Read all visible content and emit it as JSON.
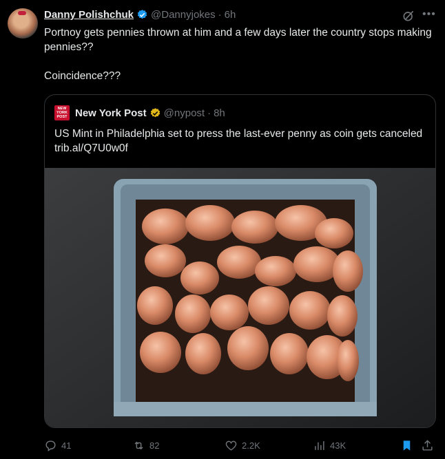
{
  "author": {
    "name": "Danny Polishchuk",
    "handle": "@Dannyjokes",
    "time": "6h"
  },
  "tweet": {
    "line1": "Portnoy gets pennies thrown at him and a few days later the country stops making pennies??",
    "line2": "Coincidence???"
  },
  "quote": {
    "logo_text": "NEW YORK POST",
    "name": "New York Post",
    "handle": "@nypost",
    "time": "8h",
    "text": "US Mint in Philadelphia set to press the last-ever penny as coin gets canceled trib.al/Q7U0w0f"
  },
  "actions": {
    "replies": "41",
    "reposts": "82",
    "likes": "2.2K",
    "views": "43K"
  },
  "icons": [
    "grok-icon",
    "more-icon",
    "verified-icon",
    "gold-verified-icon",
    "reply-icon",
    "repost-icon",
    "like-icon",
    "views-icon",
    "bookmark-icon",
    "share-icon"
  ],
  "colors": {
    "background": "#000000",
    "text": "#e7e9ea",
    "muted": "#71767b",
    "verified_blue": "#1d9bf0",
    "verified_gold": "#e2b719",
    "bookmark_active": "#1d9bf0",
    "nypost_red": "#c8102e"
  }
}
